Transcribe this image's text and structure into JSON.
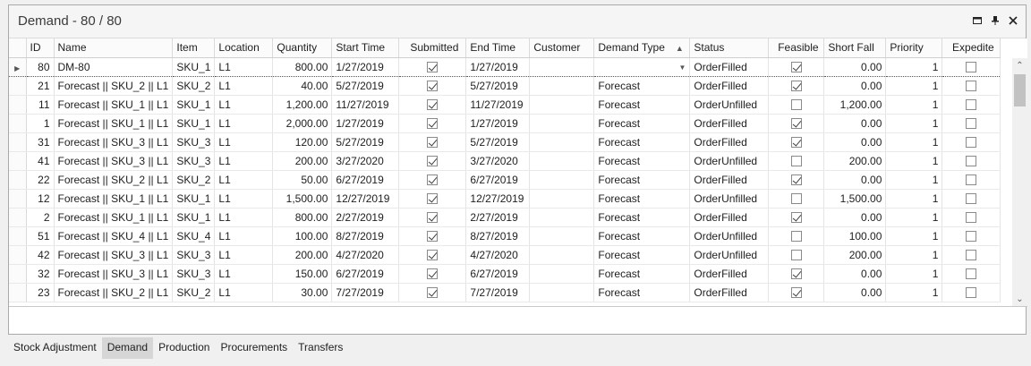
{
  "window": {
    "title": "Demand - 80 / 80"
  },
  "columns": [
    "ID",
    "Name",
    "Item",
    "Location",
    "Quantity",
    "Start Time",
    "Submitted",
    "End Time",
    "Customer",
    "Demand Type",
    "Status",
    "Feasible",
    "Short Fall",
    "Priority",
    "Expedite"
  ],
  "sorted_column": "Demand Type",
  "rows": [
    {
      "id": "80",
      "name": "DM-80",
      "item": "SKU_1",
      "location": "L1",
      "quantity": "800.00",
      "start": "1/27/2019",
      "submitted": true,
      "end": "1/27/2019",
      "customer": "",
      "type": "",
      "status": "OrderFilled",
      "feasible": true,
      "shortfall": "0.00",
      "priority": "1",
      "expedite": false
    },
    {
      "id": "21",
      "name": "Forecast || SKU_2 || L1",
      "item": "SKU_2",
      "location": "L1",
      "quantity": "40.00",
      "start": "5/27/2019",
      "submitted": true,
      "end": "5/27/2019",
      "customer": "",
      "type": "Forecast",
      "status": "OrderFilled",
      "feasible": true,
      "shortfall": "0.00",
      "priority": "1",
      "expedite": false
    },
    {
      "id": "11",
      "name": "Forecast || SKU_1 || L1",
      "item": "SKU_1",
      "location": "L1",
      "quantity": "1,200.00",
      "start": "11/27/2019",
      "submitted": true,
      "end": "11/27/2019",
      "customer": "",
      "type": "Forecast",
      "status": "OrderUnfilled",
      "feasible": false,
      "shortfall": "1,200.00",
      "priority": "1",
      "expedite": false
    },
    {
      "id": "1",
      "name": "Forecast || SKU_1 || L1",
      "item": "SKU_1",
      "location": "L1",
      "quantity": "2,000.00",
      "start": "1/27/2019",
      "submitted": true,
      "end": "1/27/2019",
      "customer": "",
      "type": "Forecast",
      "status": "OrderFilled",
      "feasible": true,
      "shortfall": "0.00",
      "priority": "1",
      "expedite": false
    },
    {
      "id": "31",
      "name": "Forecast || SKU_3 || L1",
      "item": "SKU_3",
      "location": "L1",
      "quantity": "120.00",
      "start": "5/27/2019",
      "submitted": true,
      "end": "5/27/2019",
      "customer": "",
      "type": "Forecast",
      "status": "OrderFilled",
      "feasible": true,
      "shortfall": "0.00",
      "priority": "1",
      "expedite": false
    },
    {
      "id": "41",
      "name": "Forecast || SKU_3 || L1",
      "item": "SKU_3",
      "location": "L1",
      "quantity": "200.00",
      "start": "3/27/2020",
      "submitted": true,
      "end": "3/27/2020",
      "customer": "",
      "type": "Forecast",
      "status": "OrderUnfilled",
      "feasible": false,
      "shortfall": "200.00",
      "priority": "1",
      "expedite": false
    },
    {
      "id": "22",
      "name": "Forecast || SKU_2 || L1",
      "item": "SKU_2",
      "location": "L1",
      "quantity": "50.00",
      "start": "6/27/2019",
      "submitted": true,
      "end": "6/27/2019",
      "customer": "",
      "type": "Forecast",
      "status": "OrderFilled",
      "feasible": true,
      "shortfall": "0.00",
      "priority": "1",
      "expedite": false
    },
    {
      "id": "12",
      "name": "Forecast || SKU_1 || L1",
      "item": "SKU_1",
      "location": "L1",
      "quantity": "1,500.00",
      "start": "12/27/2019",
      "submitted": true,
      "end": "12/27/2019",
      "customer": "",
      "type": "Forecast",
      "status": "OrderUnfilled",
      "feasible": false,
      "shortfall": "1,500.00",
      "priority": "1",
      "expedite": false
    },
    {
      "id": "2",
      "name": "Forecast || SKU_1 || L1",
      "item": "SKU_1",
      "location": "L1",
      "quantity": "800.00",
      "start": "2/27/2019",
      "submitted": true,
      "end": "2/27/2019",
      "customer": "",
      "type": "Forecast",
      "status": "OrderFilled",
      "feasible": true,
      "shortfall": "0.00",
      "priority": "1",
      "expedite": false
    },
    {
      "id": "51",
      "name": "Forecast || SKU_4 || L1",
      "item": "SKU_4",
      "location": "L1",
      "quantity": "100.00",
      "start": "8/27/2019",
      "submitted": true,
      "end": "8/27/2019",
      "customer": "",
      "type": "Forecast",
      "status": "OrderUnfilled",
      "feasible": false,
      "shortfall": "100.00",
      "priority": "1",
      "expedite": false
    },
    {
      "id": "42",
      "name": "Forecast || SKU_3 || L1",
      "item": "SKU_3",
      "location": "L1",
      "quantity": "200.00",
      "start": "4/27/2020",
      "submitted": true,
      "end": "4/27/2020",
      "customer": "",
      "type": "Forecast",
      "status": "OrderUnfilled",
      "feasible": false,
      "shortfall": "200.00",
      "priority": "1",
      "expedite": false
    },
    {
      "id": "32",
      "name": "Forecast || SKU_3 || L1",
      "item": "SKU_3",
      "location": "L1",
      "quantity": "150.00",
      "start": "6/27/2019",
      "submitted": true,
      "end": "6/27/2019",
      "customer": "",
      "type": "Forecast",
      "status": "OrderFilled",
      "feasible": true,
      "shortfall": "0.00",
      "priority": "1",
      "expedite": false
    },
    {
      "id": "23",
      "name": "Forecast || SKU_2 || L1",
      "item": "SKU_2",
      "location": "L1",
      "quantity": "30.00",
      "start": "7/27/2019",
      "submitted": true,
      "end": "7/27/2019",
      "customer": "",
      "type": "Forecast",
      "status": "OrderFilled",
      "feasible": true,
      "shortfall": "0.00",
      "priority": "1",
      "expedite": false
    }
  ],
  "tabs": [
    {
      "label": "Stock Adjustment",
      "active": false
    },
    {
      "label": "Demand",
      "active": true
    },
    {
      "label": "Production",
      "active": false
    },
    {
      "label": "Procurements",
      "active": false
    },
    {
      "label": "Transfers",
      "active": false
    }
  ],
  "icons": {
    "pin": "pin-icon",
    "maximize": "maximize-icon",
    "close": "close-icon"
  }
}
